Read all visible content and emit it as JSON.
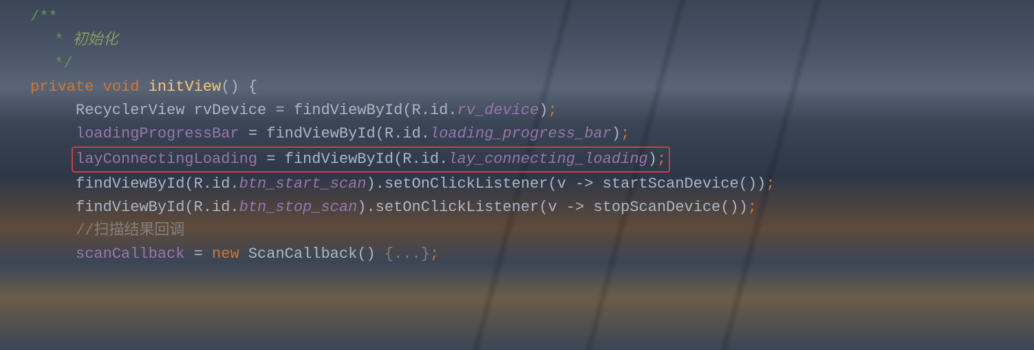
{
  "code": {
    "line1": "/**",
    "line2_star": " *",
    "line2_text": " 初始化",
    "line3": " */",
    "line4_kw1": "private",
    "line4_kw2": "void",
    "line4_method": "initView",
    "line4_tail": "() {",
    "line5_type": "RecyclerView ",
    "line5_var": "rvDevice",
    "line5_eq": " = ",
    "line5_call": "findViewById(R.id.",
    "line5_field": "rv_device",
    "line5_close": ")",
    "line5_semi": ";",
    "line6_field1": "loadingProgressBar",
    "line6_eq": " = ",
    "line6_call": "findViewById(R.id.",
    "line6_field2": "loading_progress_bar",
    "line6_close": ")",
    "line6_semi": ";",
    "line7_field1": "layConnectingLoading",
    "line7_eq": " = ",
    "line7_call": "findViewById(R.id.",
    "line7_field2": "lay_connecting_loading",
    "line7_close": ")",
    "line7_semi": ";",
    "line8_call1": "findViewById(R.id.",
    "line8_field": "btn_start_scan",
    "line8_mid": ").setOnClickListener(v -> startScanDevice())",
    "line8_semi": ";",
    "line9_call1": "findViewById(R.id.",
    "line9_field": "btn_stop_scan",
    "line9_mid": ").setOnClickListener(v -> stopScanDevice())",
    "line9_semi": ";",
    "line10": "//扫描结果回调",
    "line11_field": "scanCallback",
    "line11_eq": " = ",
    "line11_kw": "new",
    "line11_type": " ScanCallback() ",
    "line11_fold": "{...}",
    "line11_semi": ";"
  },
  "highlight_color": "#c94040"
}
